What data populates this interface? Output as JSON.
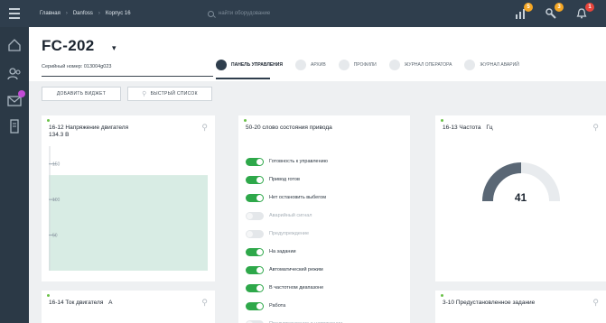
{
  "topbar": {
    "breadcrumbs": [
      "Главная",
      "Danfoss",
      "Корпус 16"
    ],
    "search_placeholder": "найти оборудование",
    "notifications": [
      {
        "icon": "chart-icon",
        "count": "5",
        "color": "#f5a623"
      },
      {
        "icon": "wrench-icon",
        "count": "3",
        "color": "#f5a623"
      },
      {
        "icon": "bell-icon",
        "count": "1",
        "color": "#e8453c"
      }
    ]
  },
  "sidebar": {
    "items": [
      {
        "icon": "home-icon"
      },
      {
        "icon": "users-icon"
      },
      {
        "icon": "mail-icon"
      },
      {
        "icon": "device-icon"
      }
    ]
  },
  "header": {
    "title": "FC-202",
    "serial": "Серийный номер: 013004g023",
    "tabs": [
      {
        "label": "ПАНЕЛЬ УПРАВЛЕНИЯ",
        "active": true
      },
      {
        "label": "АРХИВ",
        "active": false
      },
      {
        "label": "ПРОФИЛИ",
        "active": false
      },
      {
        "label": "ЖУРНАЛ ОПЕРАТОРА",
        "active": false
      },
      {
        "label": "ЖУРНАЛ АВАРИЙ",
        "active": false
      }
    ]
  },
  "actions": {
    "add_widget": "ДОБАВИТЬ ВИДЖЕТ",
    "quick_list": "БЫСТРЫЙ СПИСОК"
  },
  "widgets": {
    "voltage": {
      "title": "16-12 Напряжение двигателя",
      "value": "134.3 В"
    },
    "status_word": {
      "title": "50-20 слово состояния привода",
      "items": [
        {
          "label": "Готовность к управлению",
          "on": true
        },
        {
          "label": "Привод готов",
          "on": true
        },
        {
          "label": "Нет остановить выбегом",
          "on": true
        },
        {
          "label": "Аварийный сигнал",
          "on": false
        },
        {
          "label": "Предупреждение",
          "on": false
        },
        {
          "label": "На задании",
          "on": true
        },
        {
          "label": "Автоматический режим",
          "on": true
        },
        {
          "label": "В частотном диапазоне",
          "on": true
        },
        {
          "label": "Работа",
          "on": true
        },
        {
          "label": "Предупреждение о напряжении",
          "on": false
        }
      ]
    },
    "frequency": {
      "title": "16-13 Частота",
      "unit": "Гц",
      "value": "41"
    },
    "current": {
      "title": "16-14 Ток двигателя",
      "unit": "A"
    },
    "preset": {
      "title": "3-10 Предустановленное задание"
    }
  },
  "chart_data": {
    "type": "area",
    "title": "16-12 Напряжение двигателя",
    "yticks": [
      "150",
      "100",
      "50"
    ],
    "ylim": [
      0,
      175
    ],
    "values": [
      134.3
    ],
    "fill_color": "#d8ece4"
  }
}
